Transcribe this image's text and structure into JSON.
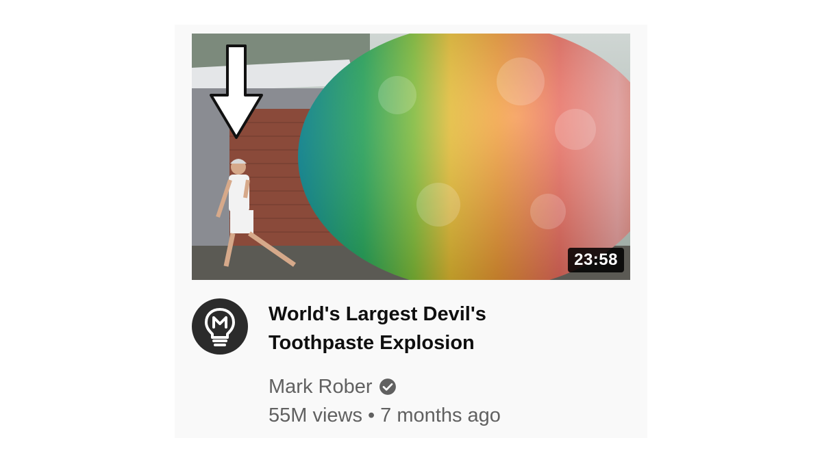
{
  "video": {
    "title_line1": "World's Largest Devil's",
    "title_line2": "Toothpaste Explosion",
    "duration": "23:58",
    "channel": "Mark Rober",
    "views": "55M views",
    "separator": "•",
    "age": "7 months ago",
    "verified_icon": "verified-check-icon",
    "avatar_icon": "lightbulb-logo-icon"
  },
  "colors": {
    "card_bg": "#f9f9f9",
    "title": "#0f0f0f",
    "secondary_text": "#606060",
    "duration_bg": "#000000",
    "avatar_bg": "#2b2b2b"
  }
}
